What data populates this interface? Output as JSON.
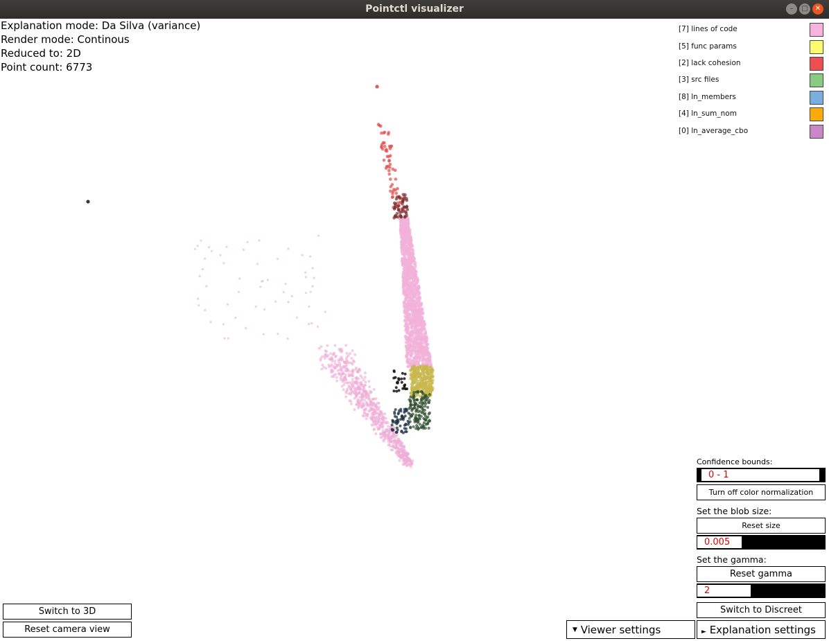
{
  "window": {
    "title": "Pointctl visualizer"
  },
  "info": {
    "explanation_mode": "Explanation mode: Da Silva (variance)",
    "render_mode": "Render mode: Continous",
    "reduced_to": "Reduced to: 2D",
    "point_count": "Point count: 6773"
  },
  "legend": [
    {
      "label": "[7] lines of code",
      "color": "#f6b3dd"
    },
    {
      "label": "[5] func params",
      "color": "#fbfb6e"
    },
    {
      "label": "[2] lack cohesion",
      "color": "#ee4e4e"
    },
    {
      "label": "[3] src files",
      "color": "#88cc82"
    },
    {
      "label": "[8] ln_members",
      "color": "#79aede"
    },
    {
      "label": "[4] ln_sum_nom",
      "color": "#fbaa0b"
    },
    {
      "label": "[0] ln_average_cbo",
      "color": "#c888c7"
    }
  ],
  "panel": {
    "confidence_label": "Confidence bounds:",
    "confidence_value": "0 - 1",
    "color_norm_button": "Turn off color normalization",
    "blob_label": "Set the blob size:",
    "reset_size_button": "Reset size",
    "blob_value": "0.005",
    "blob_level": 0.35,
    "gamma_label": "Set the gamma:",
    "reset_gamma_button": "Reset gamma",
    "gamma_value": "2",
    "gamma_level": 0.42,
    "switch_discreet_button": "Switch to Discreet",
    "explanation_settings": "Explanation settings"
  },
  "bottom_left": {
    "switch_3d": "Switch to 3D",
    "reset_camera": "Reset camera view"
  },
  "viewer_settings": "Viewer settings"
}
